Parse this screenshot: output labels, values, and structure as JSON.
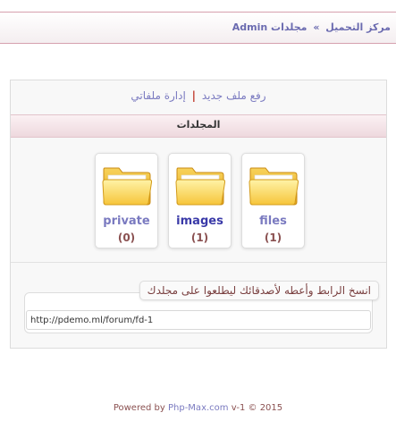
{
  "breadcrumb": {
    "root": "مركز التحميل",
    "separator": "»",
    "current": "مجلدات Admin"
  },
  "actions": {
    "upload_label": "رفع ملف جديد",
    "divider": "|",
    "manage_label": "إدارة ملفاتي"
  },
  "section": {
    "title": "المجلدات"
  },
  "folders": [
    {
      "name": "private",
      "count": "(0)",
      "color": "#7a7ac0"
    },
    {
      "name": "images",
      "count": "(1)",
      "color": "#3a3aa8"
    },
    {
      "name": "files",
      "count": "(1)",
      "color": "#7a7ac0"
    }
  ],
  "share": {
    "note": "انسخ الرابط وأعطه لأصدقائك ليطلعوا على مجلدك",
    "url": "http://pdemo.ml/forum/fd-1"
  },
  "footer": {
    "prefix": "Powered by",
    "brand": "Php-Max.com",
    "suffix": "v-1 © 2015"
  },
  "colors": {
    "accent": "#7a7ac0",
    "count": "#8a5050",
    "header_border": "#d6a0ae"
  }
}
